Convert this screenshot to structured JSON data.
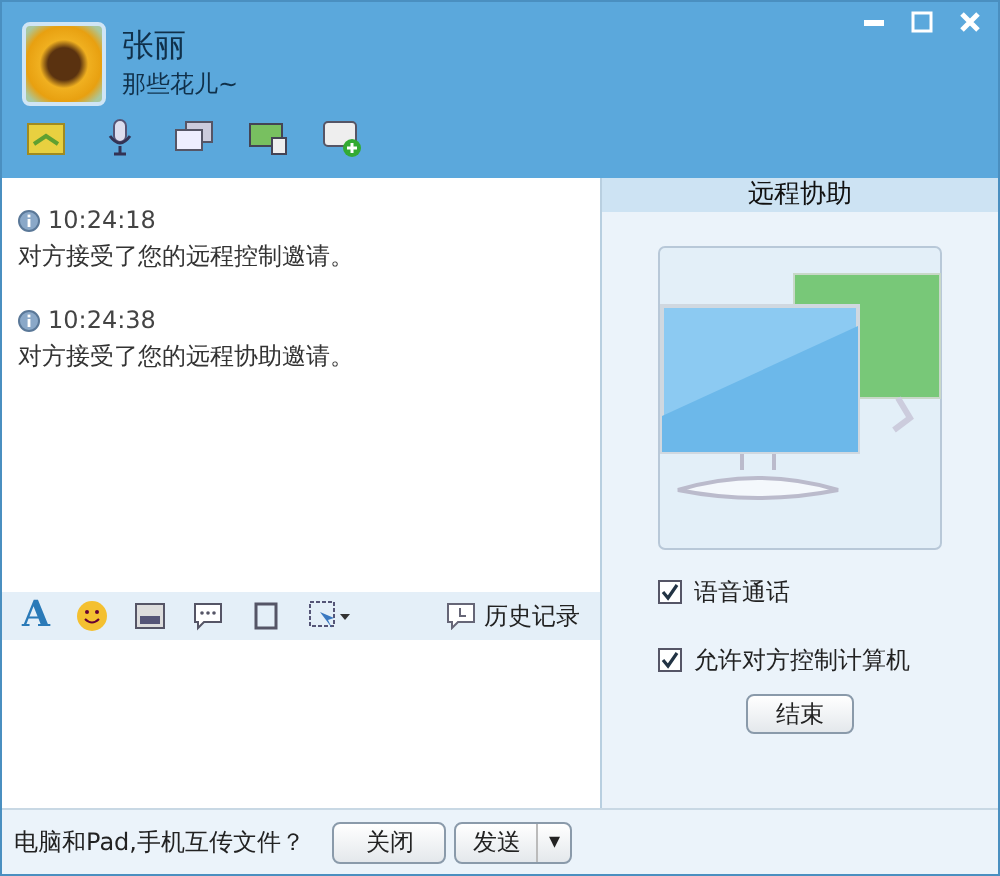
{
  "contact": {
    "name": "张丽",
    "signature": "那些花儿~"
  },
  "messages": [
    {
      "time": "10:24:18",
      "text": "对方接受了您的远程控制邀请。"
    },
    {
      "time": "10:24:38",
      "text": "对方接受了您的远程协助邀请。"
    }
  ],
  "font_button": "A",
  "history_button": "历史记录",
  "remote_panel": {
    "title": "远程协助",
    "options": [
      {
        "label": "语音通话",
        "checked": true
      },
      {
        "label": "允许对方控制计算机",
        "checked": true
      }
    ],
    "end_button": "结束"
  },
  "footer": {
    "link": "电脑和Pad,手机互传文件？",
    "close_button": "关闭",
    "send_button": "发送",
    "send_menu": "▾"
  }
}
